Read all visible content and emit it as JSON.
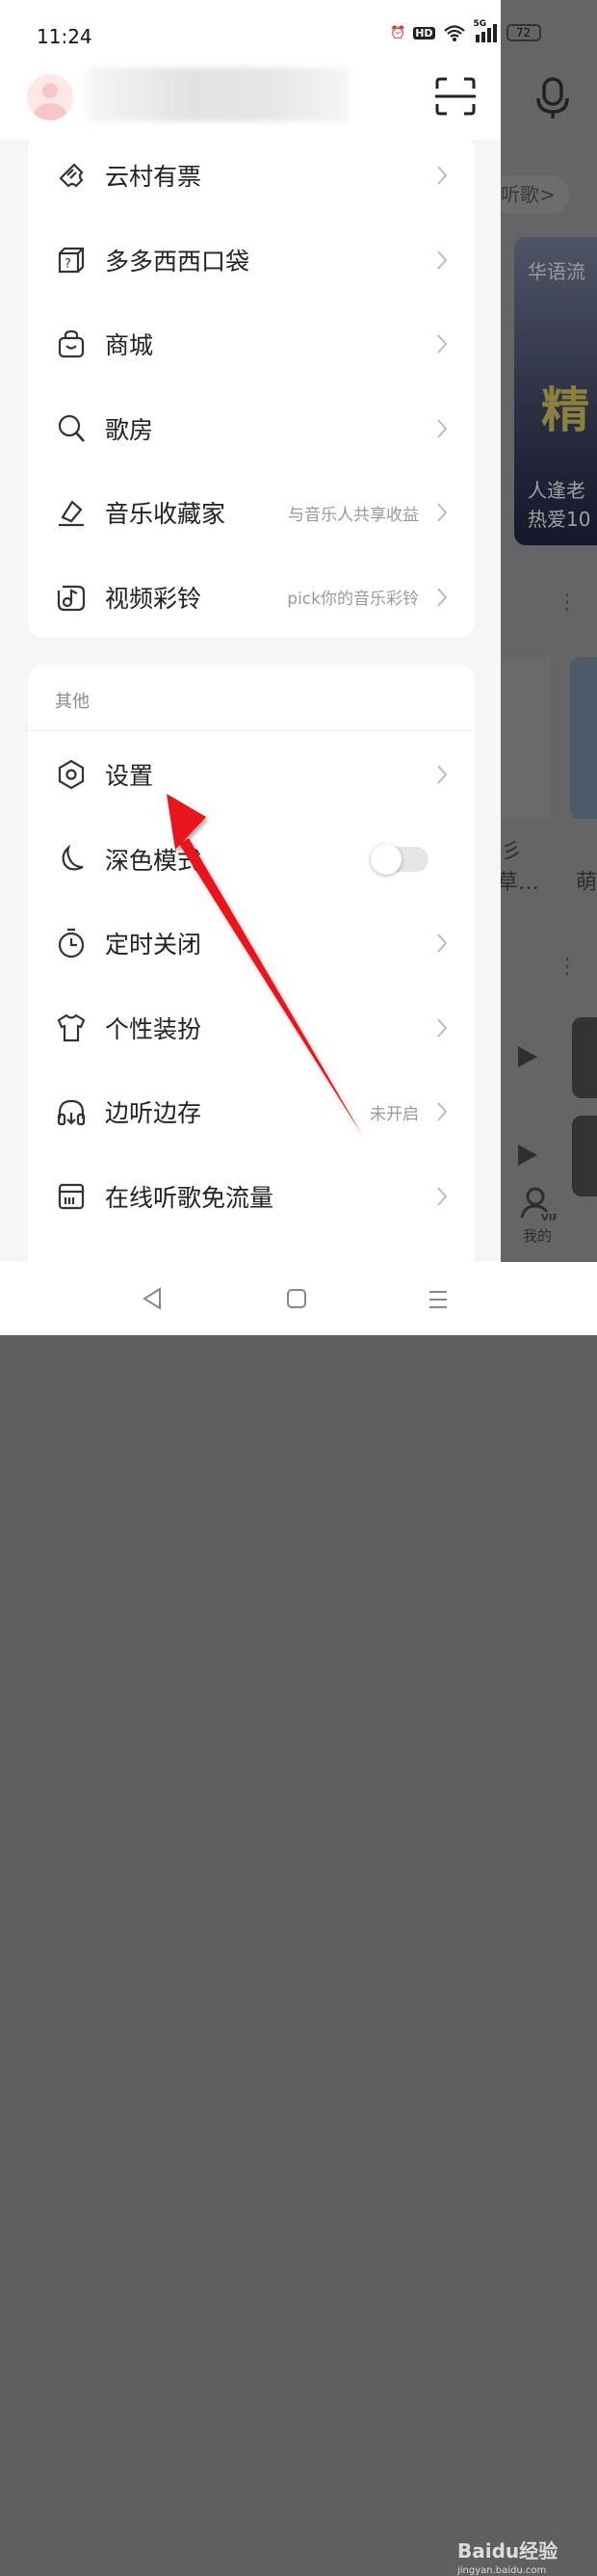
{
  "status_bar": {
    "time": "11:24",
    "network": "5G",
    "hd": "HD",
    "battery": "72"
  },
  "background_app": {
    "listen_pill": "听歌>",
    "poster_title": "华语流",
    "poster_big": "精",
    "poster_caption_1": "人逢老",
    "poster_caption_2": "热爱10",
    "card_text_1a": "彡",
    "card_text_1b": "草…",
    "card_text_2a": "「",
    "card_text_2b": "萌",
    "tab_me": "我的",
    "tab_me_badge": "VIP"
  },
  "drawer": {
    "header": {
      "avatar": "avatar",
      "scan_icon": "scan-icon"
    },
    "group1": [
      {
        "label": "云村有票",
        "icon": "ticket-icon",
        "sub": ""
      },
      {
        "label": "多多西西口袋",
        "icon": "dice-box-icon",
        "sub": ""
      },
      {
        "label": "商城",
        "icon": "shopping-bag-icon",
        "sub": ""
      },
      {
        "label": "歌房",
        "icon": "microphone-search-icon",
        "sub": ""
      },
      {
        "label": "音乐收藏家",
        "icon": "eraser-collector-icon",
        "sub": "与音乐人共享收益"
      },
      {
        "label": "视频彩铃",
        "icon": "music-note-icon",
        "sub": "pick你的音乐彩铃"
      }
    ],
    "group2": {
      "title": "其他",
      "items": [
        {
          "label": "设置",
          "icon": "settings-hexagon-icon",
          "sub": ""
        },
        {
          "label": "深色模式",
          "icon": "moon-icon",
          "toggle": false
        },
        {
          "label": "定时关闭",
          "icon": "timer-icon",
          "sub": ""
        },
        {
          "label": "个性装扮",
          "icon": "tshirt-icon",
          "sub": ""
        },
        {
          "label": "边听边存",
          "icon": "headphones-download-icon",
          "sub": "未开启"
        },
        {
          "label": "在线听歌免流量",
          "icon": "sim-card-icon",
          "sub": ""
        }
      ]
    }
  },
  "watermark": {
    "brand": "Baidu经验",
    "url": "jingyan.baidu.com"
  },
  "annotation_color": "#e8141b"
}
